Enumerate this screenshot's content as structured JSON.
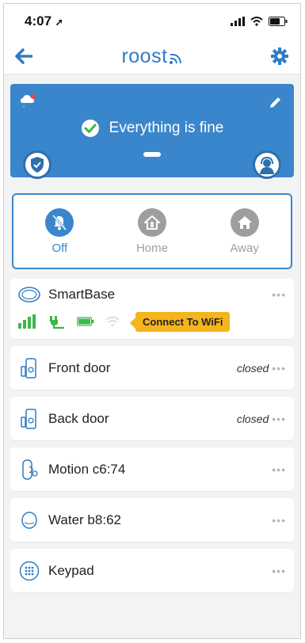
{
  "status_bar": {
    "time": "4:07"
  },
  "nav": {
    "brand": "roost"
  },
  "status_card": {
    "message": "Everything is fine"
  },
  "modes": [
    {
      "label": "Off",
      "active": true
    },
    {
      "label": "Home",
      "active": false
    },
    {
      "label": "Away",
      "active": false
    }
  ],
  "smartbase": {
    "name": "SmartBase",
    "wifi_prompt": "Connect To WiFi",
    "more": "•••"
  },
  "devices": [
    {
      "name": "Front door",
      "state": "closed",
      "icon": "door-sensor-icon",
      "more": "•••"
    },
    {
      "name": "Back door",
      "state": "closed",
      "icon": "door-sensor-icon",
      "more": "•••"
    },
    {
      "name": "Motion c6:74",
      "state": "",
      "icon": "motion-sensor-icon",
      "more": "•••"
    },
    {
      "name": "Water b8:62",
      "state": "",
      "icon": "water-sensor-icon",
      "more": "•••"
    },
    {
      "name": "Keypad",
      "state": "",
      "icon": "keypad-icon",
      "more": "•••"
    }
  ],
  "colors": {
    "primary": "#3a86cc",
    "nav_blue": "#2e7cc6",
    "ok_green": "#3db74a",
    "inactive_gray": "#9e9e9e",
    "wifi_yellow": "#f6b41d"
  }
}
